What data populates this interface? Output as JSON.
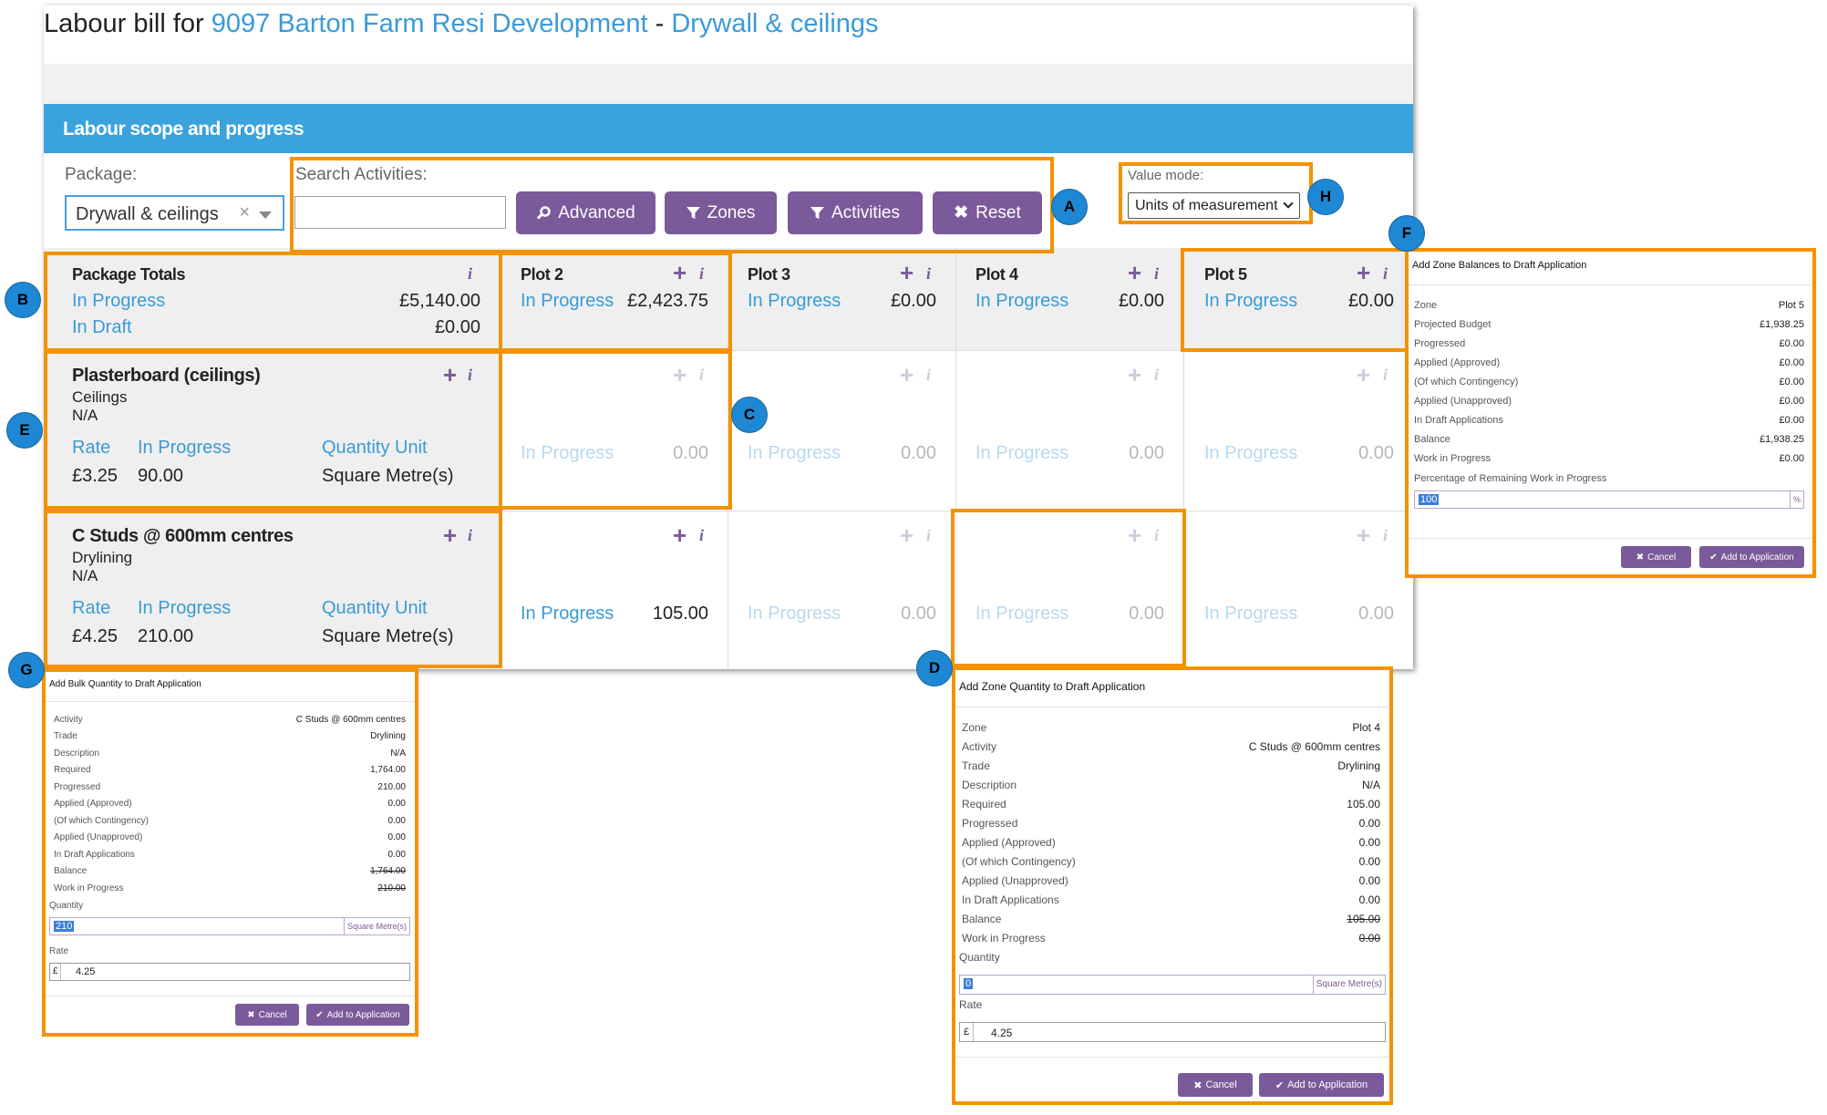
{
  "page": {
    "title_prefix": "Labour bill for",
    "project_link": "9097 Barton Farm Resi Development",
    "dash": "-",
    "package_link": "Drywall & ceilings"
  },
  "section_title": "Labour scope and progress",
  "filters": {
    "package_label": "Package:",
    "package_value": "Drywall & ceilings",
    "search_label": "Search Activities:",
    "search_value": "",
    "buttons": {
      "advanced": "Advanced",
      "zones": "Zones",
      "activities": "Activities",
      "reset": "Reset"
    },
    "value_mode_label": "Value mode:",
    "value_mode_value": "Units of measurement"
  },
  "totals": {
    "title": "Package Totals",
    "in_progress_label": "In Progress",
    "in_progress_value": "£5,140.00",
    "in_draft_label": "In Draft",
    "in_draft_value": "£0.00"
  },
  "zones": [
    {
      "name": "Plot 2",
      "status": "In Progress",
      "value": "£2,423.75"
    },
    {
      "name": "Plot 3",
      "status": "In Progress",
      "value": "£0.00"
    },
    {
      "name": "Plot 4",
      "status": "In Progress",
      "value": "£0.00"
    },
    {
      "name": "Plot 5",
      "status": "In Progress",
      "value": "£0.00"
    }
  ],
  "activities": [
    {
      "name": "Plasterboard (ceilings)",
      "trade": "Ceilings",
      "description": "N/A",
      "rate_label": "Rate",
      "rate": "£3.25",
      "progress_label": "In Progress",
      "progress": "90.00",
      "unit_label": "Quantity Unit",
      "unit": "Square Metre(s)",
      "cells": [
        {
          "status": "In Progress",
          "value": "0.00"
        },
        {
          "status": "In Progress",
          "value": "0.00"
        },
        {
          "status": "In Progress",
          "value": "0.00"
        },
        {
          "status": "In Progress",
          "value": "0.00"
        }
      ]
    },
    {
      "name": "C Studs @ 600mm centres",
      "trade": "Drylining",
      "description": "N/A",
      "rate_label": "Rate",
      "rate": "£4.25",
      "progress_label": "In Progress",
      "progress": "210.00",
      "unit_label": "Quantity Unit",
      "unit": "Square Metre(s)",
      "cells": [
        {
          "status": "In Progress",
          "value": "105.00"
        },
        {
          "status": "In Progress",
          "value": "0.00"
        },
        {
          "status": "In Progress",
          "value": "0.00"
        },
        {
          "status": "In Progress",
          "value": "0.00"
        }
      ]
    }
  ],
  "badges": {
    "a": "A",
    "b": "B",
    "c": "C",
    "d": "D",
    "e": "E",
    "f": "F",
    "g": "G",
    "h": "H"
  },
  "dialog_f": {
    "title": "Add Zone Balances to Draft Application",
    "rows": [
      [
        "Zone",
        "Plot 5"
      ],
      [
        "Projected Budget",
        "£1,938.25"
      ],
      [
        "Progressed",
        "£0.00"
      ],
      [
        "Applied (Approved)",
        "£0.00"
      ],
      [
        "(Of which Contingency)",
        "£0.00"
      ],
      [
        "Applied (Unapproved)",
        "£0.00"
      ],
      [
        "In Draft Applications",
        "£0.00"
      ],
      [
        "Balance",
        "£1,938.25"
      ],
      [
        "Work in Progress",
        "£0.00"
      ]
    ],
    "pct_label": "Percentage of Remaining Work in Progress",
    "pct_value": "100",
    "pct_unit": "%",
    "cancel": "Cancel",
    "add": "Add to Application"
  },
  "dialog_g": {
    "title": "Add Bulk Quantity to Draft Application",
    "rows": [
      [
        "Activity",
        "C Studs @ 600mm centres"
      ],
      [
        "Trade",
        "Drylining"
      ],
      [
        "Description",
        "N/A"
      ],
      [
        "Required",
        "1,764.00"
      ],
      [
        "Progressed",
        "210.00"
      ],
      [
        "Applied (Approved)",
        "0.00"
      ],
      [
        "(Of which Contingency)",
        "0.00"
      ],
      [
        "Applied (Unapproved)",
        "0.00"
      ],
      [
        "In Draft Applications",
        "0.00"
      ],
      [
        "Balance",
        "1,764.00"
      ],
      [
        "Work in Progress",
        "210.00"
      ]
    ],
    "qty_label": "Quantity",
    "qty_value": "210",
    "qty_unit": "Square Metre(s)",
    "rate_label": "Rate",
    "rate_currency": "£",
    "rate_value": "4.25",
    "cancel": "Cancel",
    "add": "Add to Application"
  },
  "dialog_d": {
    "title": "Add Zone Quantity to Draft Application",
    "rows": [
      [
        "Zone",
        "Plot 4"
      ],
      [
        "Activity",
        "C Studs @ 600mm centres"
      ],
      [
        "Trade",
        "Drylining"
      ],
      [
        "Description",
        "N/A"
      ],
      [
        "Required",
        "105.00"
      ],
      [
        "Progressed",
        "0.00"
      ],
      [
        "Applied (Approved)",
        "0.00"
      ],
      [
        "(Of which Contingency)",
        "0.00"
      ],
      [
        "Applied (Unapproved)",
        "0.00"
      ],
      [
        "In Draft Applications",
        "0.00"
      ],
      [
        "Balance",
        "105.00"
      ],
      [
        "Work in Progress",
        "0.00"
      ]
    ],
    "qty_label": "Quantity",
    "qty_value": "0",
    "qty_unit": "Square Metre(s)",
    "rate_label": "Rate",
    "rate_currency": "£",
    "rate_value": "4.25",
    "cancel": "Cancel",
    "add": "Add to Application"
  }
}
